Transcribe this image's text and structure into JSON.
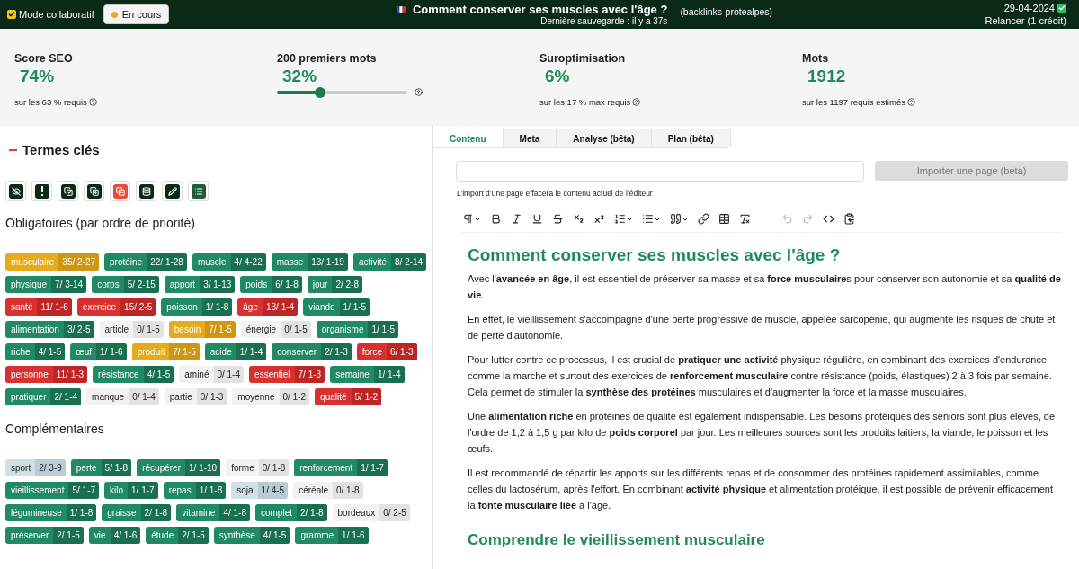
{
  "header": {
    "collab": {
      "label": "Mode collaboratif",
      "checked": true
    },
    "status": {
      "label": "En cours",
      "color": "#f5a623"
    },
    "title": "Comment conserver ses muscles avec l'âge ?",
    "saved": "Dernière sauvegarde : il y a 37s",
    "project": "(backlinks-protealpes)",
    "date": "29-04-2024",
    "date_checked": true,
    "rerun": "Relancer (1 crédit)"
  },
  "stats": [
    {
      "kind": "score",
      "label": "Score SEO",
      "value": "74%",
      "note": "sur les 63 % requis"
    },
    {
      "kind": "slider",
      "label": "200 premiers mots",
      "value": "32%",
      "level": 0.33
    },
    {
      "kind": "score",
      "label": "Suroptimisation",
      "value": "6%",
      "note": "sur les 17 % max requis"
    },
    {
      "kind": "score",
      "label": "Mots",
      "value": "1912",
      "note": "sur les 1197 requis estimés"
    }
  ],
  "terms": {
    "title": "Termes clés",
    "expanded": true,
    "groups": [
      {
        "title": "Obligatoires (par ordre de priorité)",
        "tags": [
          {
            "term": "musculaire",
            "count": "35/ 2-27",
            "kind": "warn"
          },
          {
            "term": "protéine",
            "count": "22/ 1-28",
            "kind": "good"
          },
          {
            "term": "muscle",
            "count": "4/ 4-22",
            "kind": "good"
          },
          {
            "term": "masse",
            "count": "13/ 1-19",
            "kind": "good"
          },
          {
            "term": "activité",
            "count": "8/ 2-14",
            "kind": "good"
          },
          {
            "term": "physique",
            "count": "7/ 3-14",
            "kind": "good"
          },
          {
            "term": "corps",
            "count": "5/ 2-15",
            "kind": "good"
          },
          {
            "term": "apport",
            "count": "3/ 1-13",
            "kind": "good"
          },
          {
            "term": "poids",
            "count": "6/ 1-8",
            "kind": "good"
          },
          {
            "term": "jour",
            "count": "2/ 2-8",
            "kind": "good"
          },
          {
            "term": "santé",
            "count": "11/ 1-6",
            "kind": "bad"
          },
          {
            "term": "exercice",
            "count": "15/ 2-5",
            "kind": "bad"
          },
          {
            "term": "poisson",
            "count": "1/ 1-8",
            "kind": "good"
          },
          {
            "term": "âge",
            "count": "13/ 1-4",
            "kind": "bad"
          },
          {
            "term": "viande",
            "count": "1/ 1-5",
            "kind": "good"
          },
          {
            "term": "alimentation",
            "count": "3/ 2-5",
            "kind": "good"
          },
          {
            "term": "article",
            "count": "0/ 1-5",
            "kind": "missing"
          },
          {
            "term": "besoin",
            "count": "7/ 1-5",
            "kind": "warn"
          },
          {
            "term": "énergie",
            "count": "0/ 1-5",
            "kind": "missing"
          },
          {
            "term": "organisme",
            "count": "1/ 1-5",
            "kind": "good"
          },
          {
            "term": "riche",
            "count": "4/ 1-5",
            "kind": "good"
          },
          {
            "term": "œuf",
            "count": "1/ 1-6",
            "kind": "good"
          },
          {
            "term": "produit",
            "count": "7/ 1-5",
            "kind": "warn"
          },
          {
            "term": "acide",
            "count": "1/ 1-4",
            "kind": "good"
          },
          {
            "term": "conserver",
            "count": "2/ 1-3",
            "kind": "good"
          },
          {
            "term": "force",
            "count": "6/ 1-3",
            "kind": "bad"
          },
          {
            "term": "personne",
            "count": "11/ 1-3",
            "kind": "bad"
          },
          {
            "term": "résistance",
            "count": "4/ 1-5",
            "kind": "good"
          },
          {
            "term": "aminé",
            "count": "0/ 1-4",
            "kind": "missing"
          },
          {
            "term": "essentiel",
            "count": "7/ 1-3",
            "kind": "bad"
          },
          {
            "term": "semaine",
            "count": "1/ 1-4",
            "kind": "good"
          },
          {
            "term": "pratiquer",
            "count": "2/ 1-4",
            "kind": "good"
          },
          {
            "term": "manque",
            "count": "0/ 1-4",
            "kind": "missing"
          },
          {
            "term": "partie",
            "count": "0/ 1-3",
            "kind": "missing"
          },
          {
            "term": "moyenne",
            "count": "0/ 1-2",
            "kind": "missing"
          },
          {
            "term": "qualité",
            "count": "5/ 1-2",
            "kind": "bad"
          }
        ]
      },
      {
        "title": "Complémentaires",
        "tags": [
          {
            "term": "sport",
            "count": "2/ 3-9",
            "kind": "low"
          },
          {
            "term": "perte",
            "count": "5/ 1-8",
            "kind": "good"
          },
          {
            "term": "récupérer",
            "count": "1/ 1-10",
            "kind": "good"
          },
          {
            "term": "forme",
            "count": "0/ 1-8",
            "kind": "missing"
          },
          {
            "term": "renforcement",
            "count": "1/ 1-7",
            "kind": "good"
          },
          {
            "term": "vieillissement",
            "count": "5/ 1-7",
            "kind": "good"
          },
          {
            "term": "kilo",
            "count": "1/ 1-7",
            "kind": "good"
          },
          {
            "term": "repas",
            "count": "1/ 1-8",
            "kind": "good"
          },
          {
            "term": "soja",
            "count": "1/ 4-5",
            "kind": "low"
          },
          {
            "term": "céréale",
            "count": "0/ 1-8",
            "kind": "missing"
          },
          {
            "term": "légumineuse",
            "count": "1/ 1-8",
            "kind": "good"
          },
          {
            "term": "graisse",
            "count": "2/ 1-8",
            "kind": "good"
          },
          {
            "term": "vitamine",
            "count": "4/ 1-8",
            "kind": "good"
          },
          {
            "term": "complet",
            "count": "2/ 1-8",
            "kind": "good"
          },
          {
            "term": "bordeaux",
            "count": "0/ 2-5",
            "kind": "missing"
          },
          {
            "term": "préserver",
            "count": "2/ 1-5",
            "kind": "good"
          },
          {
            "term": "vie",
            "count": "4/ 1-6",
            "kind": "good"
          },
          {
            "term": "étude",
            "count": "2/ 1-5",
            "kind": "good"
          },
          {
            "term": "synthèse",
            "count": "4/ 1-5",
            "kind": "good"
          },
          {
            "term": "gramme",
            "count": "1/ 1-6",
            "kind": "good"
          }
        ]
      }
    ]
  },
  "tabs": [
    {
      "label": "Contenu",
      "selected": true
    },
    {
      "label": "Meta",
      "selected": false
    },
    {
      "label": "Analyse (bêta)",
      "selected": false
    },
    {
      "label": "Plan (bêta)",
      "selected": false
    }
  ],
  "import": {
    "button": "Importer une page (beta)",
    "disabled": true,
    "note": "L’import d’une page effacera le contenu actuel de l’éditeur"
  },
  "editor": {
    "history_disabled": true,
    "blocks": [
      {
        "kind": "h1",
        "text": "Comment conserver ses muscles avec l'âge ?"
      },
      {
        "kind": "p",
        "text": "Avec l'**avancée en âge**, il est essentiel de préserver sa masse et sa **force musculaire**s pour conserver son autonomie et sa **qualité de vie**."
      },
      {
        "kind": "p",
        "text": "En effet, le vieillissement s'accompagne d'une perte progressive de muscle, appelée sarcopénie, qui augmente les risques de chute et de perte d'autonomie."
      },
      {
        "kind": "p",
        "text": "Pour lutter contre ce processus, il est crucial de **pratiquer une activité** physique régulière, en combinant des exercices d'endurance comme la marche et surtout des exercices de **renforcement musculaire** contre résistance (poids, élastiques) 2 à 3 fois par semaine. Cela permet de stimuler la **synthèse des protéines** musculaires et d'augmenter la force et la masse musculaires."
      },
      {
        "kind": "p",
        "text": "Une **alimentation riche** en protéines de qualité est également indispensable. Les besoins protéiques des seniors sont plus élevés, de l'ordre de 1,2 à 1,5 g par kilo de **poids corporel** par jour. Les meilleures sources sont les produits laitiers, la viande, le poisson et les œufs."
      },
      {
        "kind": "p",
        "text": "Il est recommandé de répartir les apports sur les différents repas et de consommer des protéines rapidement assimilables, comme celles du lactosérum, après l'effort. En combinant **activité physique** et alimentation protéique, il est possible de prévenir efficacement la **fonte musculaire liée** à l'âge."
      },
      {
        "kind": "h2",
        "text": "Comprendre le vieillissement musculaire"
      }
    ]
  }
}
